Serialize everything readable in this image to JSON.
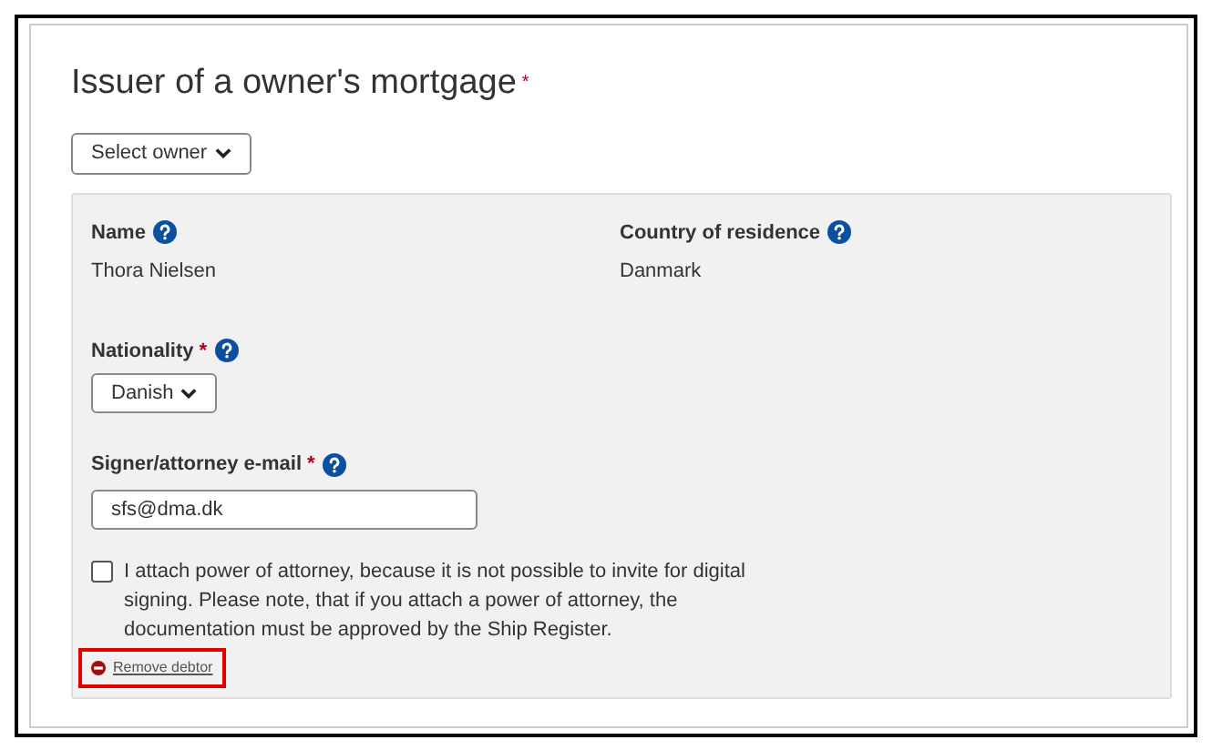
{
  "title": "Issuer of a owner's mortgage",
  "required_mark": "*",
  "owner_select": {
    "label": "Select owner"
  },
  "details": [
    {
      "label": "Name",
      "value": "Thora Nielsen"
    },
    {
      "label": "Country of residence",
      "value": "Danmark"
    }
  ],
  "nationality": {
    "label": "Nationality",
    "required_mark": "*",
    "value": "Danish"
  },
  "email": {
    "label": "Signer/attorney e-mail",
    "required_mark": "*",
    "value": "sfs@dma.dk"
  },
  "power_of_attorney": {
    "checked": false,
    "text": "I attach power of attorney, because it is not possible to invite for digital signing. Please note, that if you attach a power of attorney, the documentation must be approved by the Ship Register."
  },
  "remove_link": {
    "label": "Remove debtor",
    "highlighted": true
  }
}
